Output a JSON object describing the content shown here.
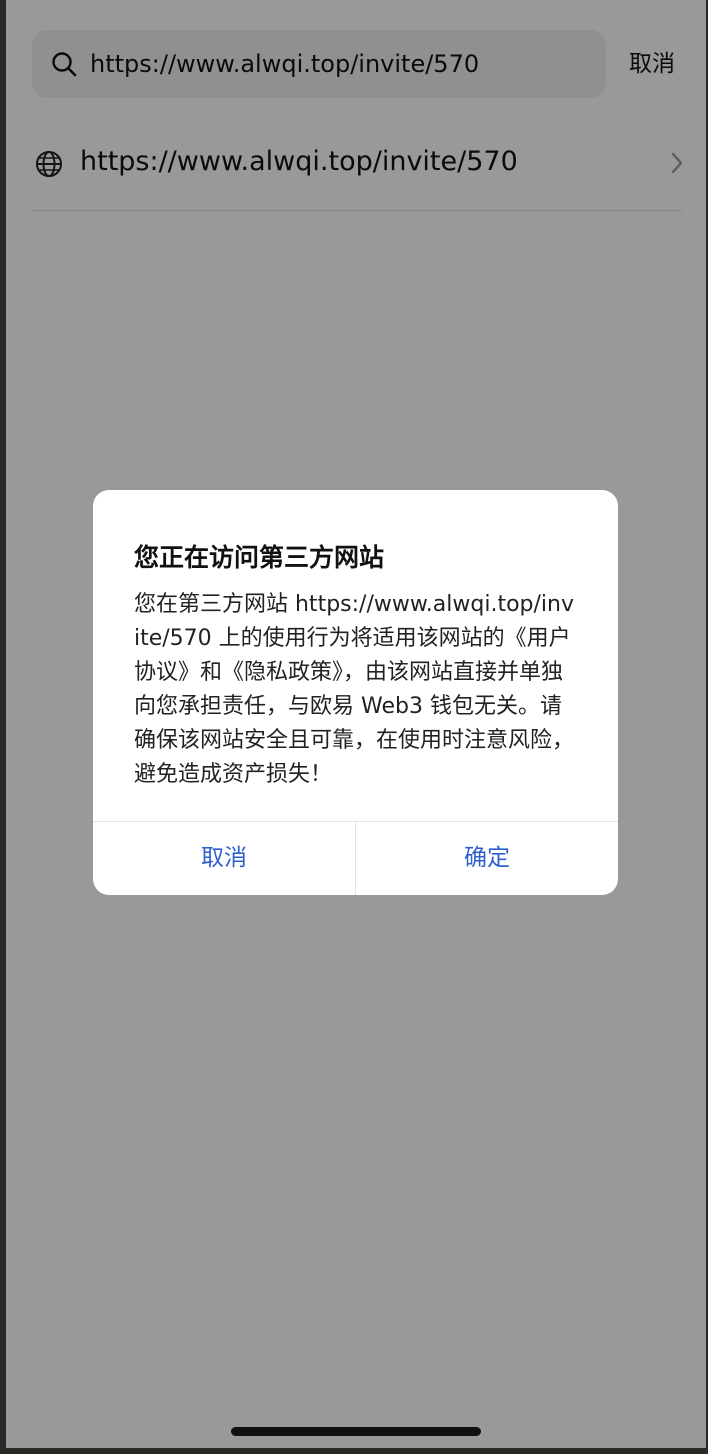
{
  "search": {
    "value": "https://www.alwqi.top/invite/570",
    "cancel_label": "取消",
    "icon": "search-icon"
  },
  "suggestion": {
    "icon": "globe-icon",
    "url": "https://www.alwqi.top/invite/570",
    "chevron_icon": "chevron-right-icon"
  },
  "dialog": {
    "title": "您正在访问第三方网站",
    "body": "您在第三方网站 https://www.alwqi.top/invite/570 上的使用行为将适用该网站的《用户协议》和《隐私政策》，由该网站直接并单独向您承担责任，与欧易 Web3 钱包无关。请确保该网站安全且可靠，在使用时注意风险，避免造成资产损失！",
    "cancel_label": "取消",
    "confirm_label": "确定"
  },
  "colors": {
    "accent": "#2d5fd0",
    "overlay": "rgba(0,0,0,0.40)"
  }
}
